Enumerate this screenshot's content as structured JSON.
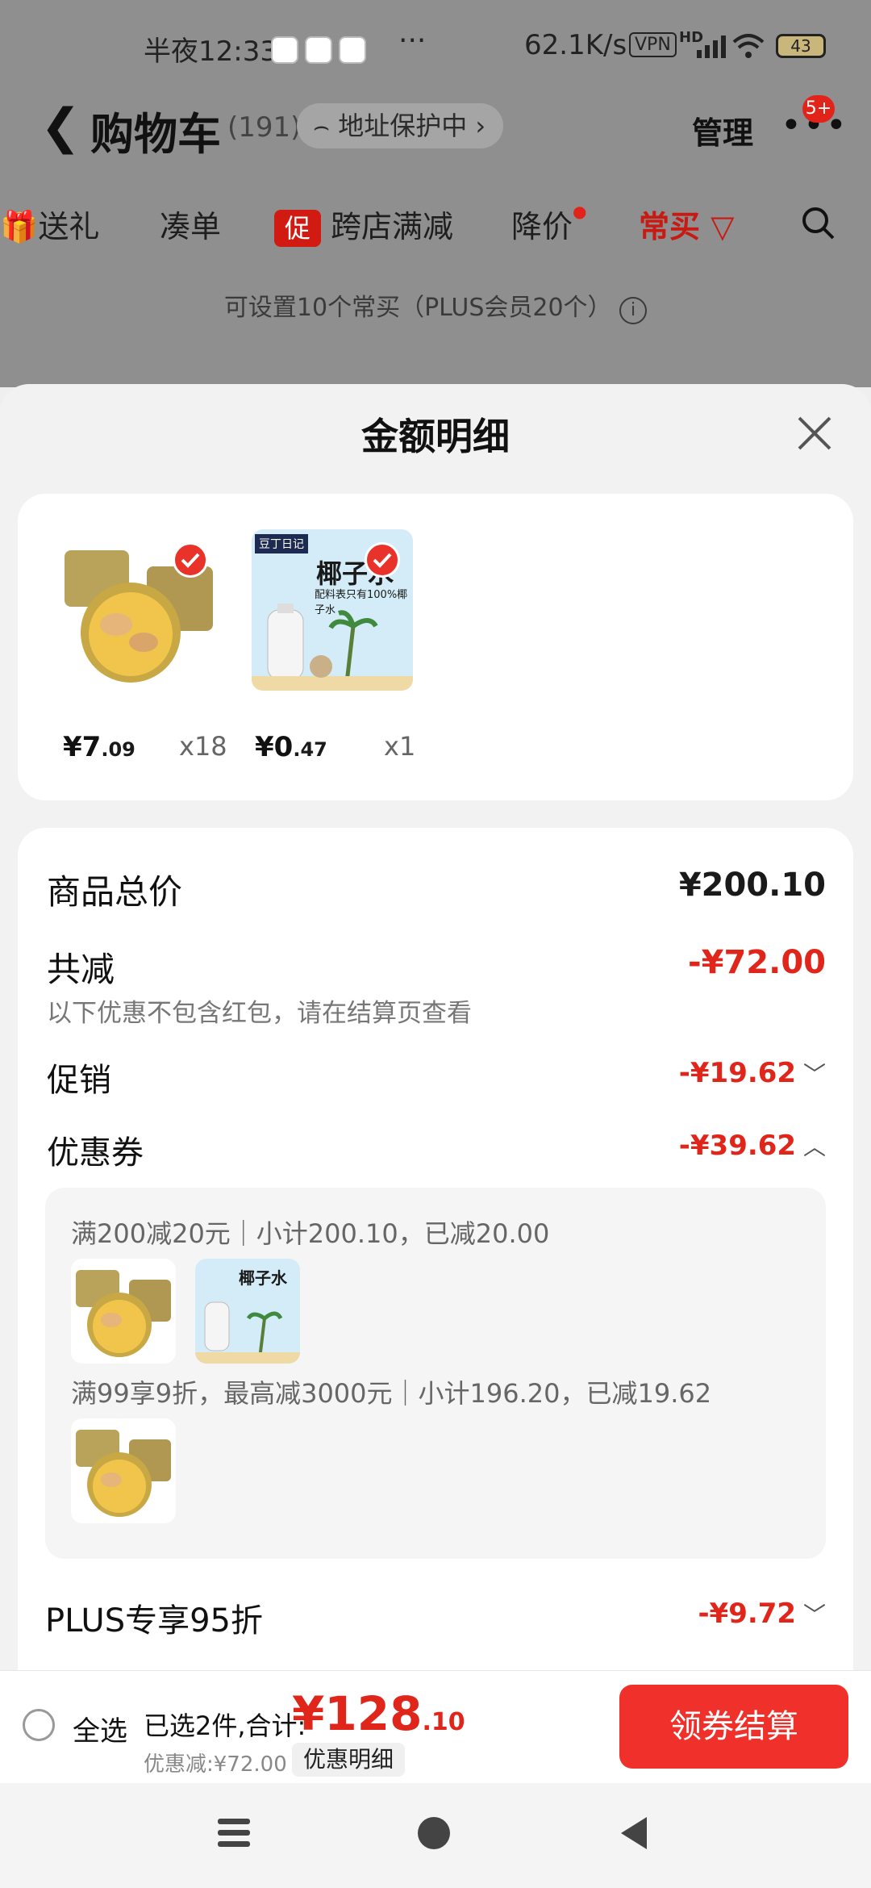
{
  "status_bar": {
    "time": "半夜12:33",
    "dots": "···",
    "net_speed": "62.1K/s",
    "vpn": "VPN",
    "hd": "HD",
    "battery": "43"
  },
  "header": {
    "title": "购物车",
    "count": "(191)",
    "address_pill": "地址保护中",
    "manage": "管理",
    "msg_badge": "5+"
  },
  "tabs": [
    {
      "label": "送礼"
    },
    {
      "label": "凑单"
    },
    {
      "label": "跨店满减",
      "badge": "促"
    },
    {
      "label": "降价"
    },
    {
      "label": "常买"
    }
  ],
  "hint": "可设置10个常买（PLUS会员20个）",
  "sheet": {
    "title": "金额明细",
    "products": [
      {
        "price_int": "¥7",
        "price_dec": ".09",
        "qty": "x18",
        "icon": "soup-product-image"
      },
      {
        "price_int": "¥0",
        "price_dec": ".47",
        "qty": "x1",
        "icon": "coconut-water-image",
        "img_text": "椰子水",
        "img_sub": "配料表只有100%椰子水",
        "brand": "豆丁日记"
      }
    ],
    "breakdown": {
      "total_label": "商品总价",
      "total_value": "¥200.10",
      "reduce_label": "共减",
      "reduce_value": "-¥72.00",
      "reduce_note": "以下优惠不包含红包，请在结算页查看",
      "promo_label": "促销",
      "promo_value": "-¥19.62",
      "coupon_label": "优惠券",
      "coupon_value": "-¥39.62",
      "coupon_rule1": "满200减20元｜小计200.10，已减20.00",
      "coupon_rule2": "满99享9折，最高减3000元｜小计196.20，已减19.62",
      "plus_label": "PLUS专享95折",
      "plus_value": "-¥9.72"
    }
  },
  "bottom": {
    "select_all": "全选",
    "selected": "已选2件,合计:",
    "total_int": "¥128",
    "total_dec": ".10",
    "discount": "优惠减:¥72.00",
    "detail_btn": "优惠明细",
    "checkout": "领券结算"
  },
  "colors": {
    "accent": "#e0251b",
    "checkout_bg": "#f0302a"
  }
}
